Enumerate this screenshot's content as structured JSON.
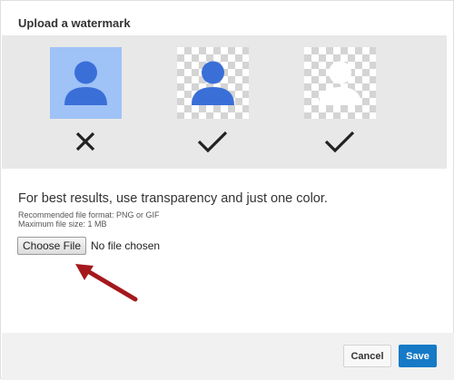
{
  "dialog": {
    "title": "Upload a watermark"
  },
  "previews": [
    {
      "style": "solid-background",
      "icon": "person-icon",
      "icon_color": "#3a6fd8",
      "background": "#9fc2f7",
      "verdict_icon": "cross-icon"
    },
    {
      "style": "transparent-background",
      "icon": "person-icon",
      "icon_color": "#3a6fd8",
      "background": "checkerboard",
      "verdict_icon": "checkmark-icon"
    },
    {
      "style": "transparent-background",
      "icon": "person-icon",
      "icon_color": "#ffffff",
      "background": "checkerboard",
      "verdict_icon": "checkmark-icon"
    }
  ],
  "instructions": {
    "hint": "For best results, use transparency and just one color.",
    "format_note": "Recommended file format: PNG or GIF",
    "size_note": "Maximum file size: 1 MB"
  },
  "file_input": {
    "button_label": "Choose File",
    "status": "No file chosen"
  },
  "annotation": {
    "icon": "arrow-icon",
    "color": "#a4191d"
  },
  "footer": {
    "cancel_label": "Cancel",
    "save_label": "Save"
  },
  "colors": {
    "primary": "#167ac6",
    "preview_band": "#e8e8e8",
    "footer_bg": "#f1f1f1"
  }
}
